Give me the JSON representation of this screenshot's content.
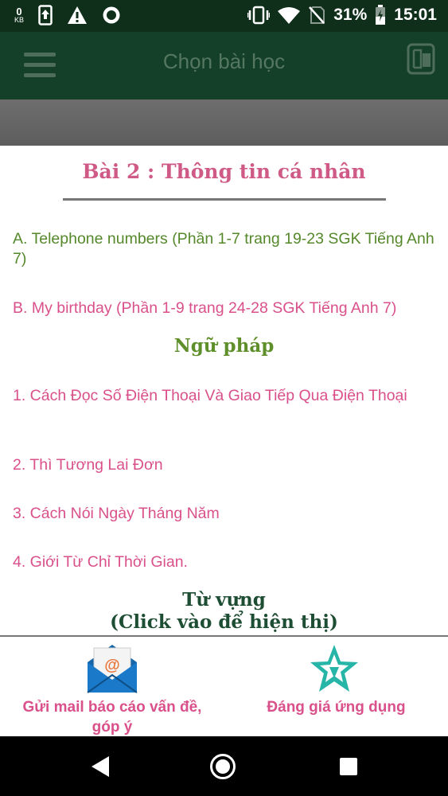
{
  "status_bar": {
    "speed_value": "0",
    "speed_unit": "KB",
    "battery_percent": "31%",
    "time": "15:01"
  },
  "app_bar": {
    "title": "Chọn bài học"
  },
  "dialog": {
    "title": "Bài 2 : Thông tin cá nhân",
    "parts": [
      "A. Telephone numbers (Phần 1-7 trang 19-23 SGK Tiếng Anh 7)",
      "B. My birthday (Phần 1-9 trang 24-28 SGK Tiếng Anh 7)"
    ],
    "grammar_heading": "Ngữ pháp",
    "grammar_items": [
      "1. Cách Đọc Số Điện Thoại Và Giao Tiếp Qua Điện Thoại",
      "2. Thì Tương Lai Đơn",
      "3. Cách Nói Ngày Tháng Năm",
      "4. Giới Từ Chỉ Thời Gian."
    ],
    "vocab_heading_line1": "Từ vựng",
    "vocab_heading_line2": "(Click vào để hiện thị)"
  },
  "bottom_bar": {
    "mail_label_line1": "Gửi mail báo cáo vấn đề,",
    "mail_label_line2": "góp ý",
    "rate_label": "Đáng giá ứng dụng"
  },
  "colors": {
    "app_bar": "#14402a",
    "status_bar": "#0f2f1b",
    "accent_pink": "#d9508a",
    "accent_green": "#55882a"
  },
  "icons": {
    "status_left": [
      "upload-notification-icon",
      "warning-icon",
      "circle-app-icon"
    ],
    "status_right": [
      "vibrate-icon",
      "wifi-icon",
      "no-sim-icon",
      "battery-charging-icon"
    ],
    "app_bar": [
      "hamburger-menu-icon",
      "book-icon"
    ],
    "bottom_bar": [
      "mail-envelope-icon",
      "star-icon"
    ],
    "nav": [
      "back-icon",
      "home-icon",
      "recents-icon"
    ]
  }
}
